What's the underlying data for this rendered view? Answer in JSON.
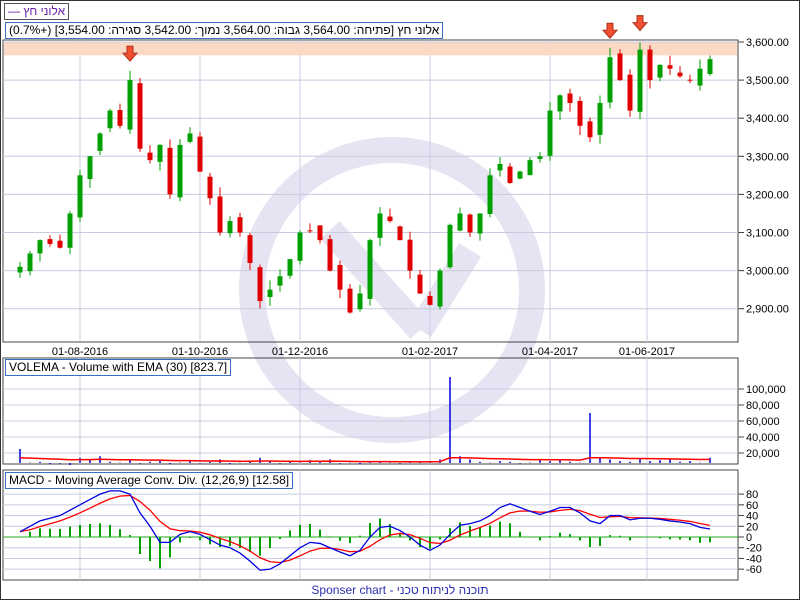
{
  "header": {
    "symbol_label": "אלוני חץ —",
    "info": "אלוני חץ [פתיחה: 3,564.00  גבוה: 3,564.00  נמוך: 3,542.00  סגירה: 3,554.00] (+0.7%)"
  },
  "footer": "Sponser chart - תוכנה לניתוח טכני",
  "colors": {
    "up": "#00a000",
    "down": "#e00000",
    "volume": "#0000e0",
    "ema": "#ff0000",
    "macd": "#0000e0",
    "signal": "#ff0000",
    "hist": "#00a000",
    "band": "#fcd9c4",
    "arrow": "#f05030"
  },
  "chart_data": [
    {
      "type": "candlestick",
      "title": "אלוני חץ",
      "ylim": [
        2830,
        3620
      ],
      "yticks": [
        2900,
        3000,
        3100,
        3200,
        3300,
        3400,
        3500,
        3600
      ],
      "ytick_labels": [
        "2,900.00",
        "3,000.00",
        "3,100.00",
        "3,200.00",
        "3,300.00",
        "3,400.00",
        "3,500.00",
        "3,600.00"
      ],
      "xtick_labels": [
        "01-08-2016",
        "01-10-2016",
        "01-12-2016",
        "01-02-2017",
        "01-04-2017",
        "01-06-2017"
      ],
      "xtick_index": [
        6,
        18,
        28,
        41,
        53,
        62.7
      ],
      "resistance_band": [
        3565,
        3600
      ],
      "arrow_index": [
        11,
        59,
        62
      ],
      "close": [
        3010,
        3045,
        3080,
        3070,
        3060,
        3150,
        3250,
        3300,
        3360,
        3420,
        3380,
        3500,
        3320,
        3290,
        3330,
        3200,
        3330,
        3360,
        3260,
        3190,
        3100,
        3130,
        3100,
        3020,
        2920,
        2950,
        2985,
        3030,
        3100,
        3105,
        3080,
        3000,
        2950,
        2890,
        2940,
        3080,
        3150,
        3130,
        3080,
        3000,
        2940,
        2910,
        3000,
        3120,
        3150,
        3100,
        3150,
        3250,
        3280,
        3230,
        3260,
        3290,
        3300,
        3420,
        3460,
        3440,
        3380,
        3350,
        3440,
        3560,
        3500,
        3420,
        3580,
        3500,
        3540,
        3530,
        3510,
        3500,
        3530,
        3555
      ]
    },
    {
      "type": "bar",
      "title": "VOLEMA - Volume with EMA (30) [823.7]",
      "ylim": [
        0,
        110000
      ],
      "yticks": [
        20000,
        40000,
        60000,
        80000,
        100000
      ],
      "ytick_labels": [
        "20,000",
        "40,000",
        "60,000",
        "80,000",
        "100,000"
      ],
      "volume": [
        25000,
        8000,
        9000,
        6000,
        7000,
        5000,
        14000,
        12000,
        16000,
        9000,
        8000,
        12000,
        7000,
        9000,
        11000,
        6000,
        8000,
        10000,
        7000,
        9000,
        12000,
        6000,
        8000,
        9000,
        14000,
        10000,
        7000,
        9000,
        8000,
        11000,
        10000,
        12000,
        7000,
        8000,
        6000,
        9000,
        10000,
        8000,
        7000,
        9000,
        8000,
        10000,
        12000,
        115000,
        16000,
        12000,
        9000,
        8000,
        10000,
        9000,
        7000,
        8000,
        11000,
        10000,
        12000,
        9000,
        8000,
        70000,
        14000,
        12000,
        10000,
        9000,
        13000,
        10000,
        11000,
        12000,
        9000,
        10000,
        8000,
        14000
      ]
    },
    {
      "type": "line",
      "title": "MACD - Moving Average Conv. Div. (12,26,9) [12.58]",
      "ylim": [
        -75,
        95
      ],
      "yticks": [
        -60,
        -40,
        -20,
        0,
        20,
        40,
        60,
        80
      ],
      "ytick_labels": [
        "-60",
        "-40",
        "-20",
        "0",
        "20",
        "40",
        "60",
        "80"
      ],
      "macd": [
        10,
        20,
        30,
        35,
        40,
        50,
        60,
        70,
        80,
        86,
        86,
        80,
        45,
        20,
        -10,
        -10,
        5,
        10,
        5,
        -5,
        -15,
        -20,
        -30,
        -45,
        -62,
        -60,
        -50,
        -35,
        -20,
        -10,
        -12,
        -20,
        -28,
        -35,
        -25,
        0,
        18,
        20,
        12,
        0,
        -15,
        -25,
        -15,
        5,
        22,
        25,
        30,
        40,
        55,
        62,
        55,
        48,
        42,
        48,
        55,
        55,
        45,
        30,
        25,
        40,
        40,
        32,
        35,
        35,
        33,
        30,
        28,
        25,
        18,
        15
      ]
    }
  ]
}
